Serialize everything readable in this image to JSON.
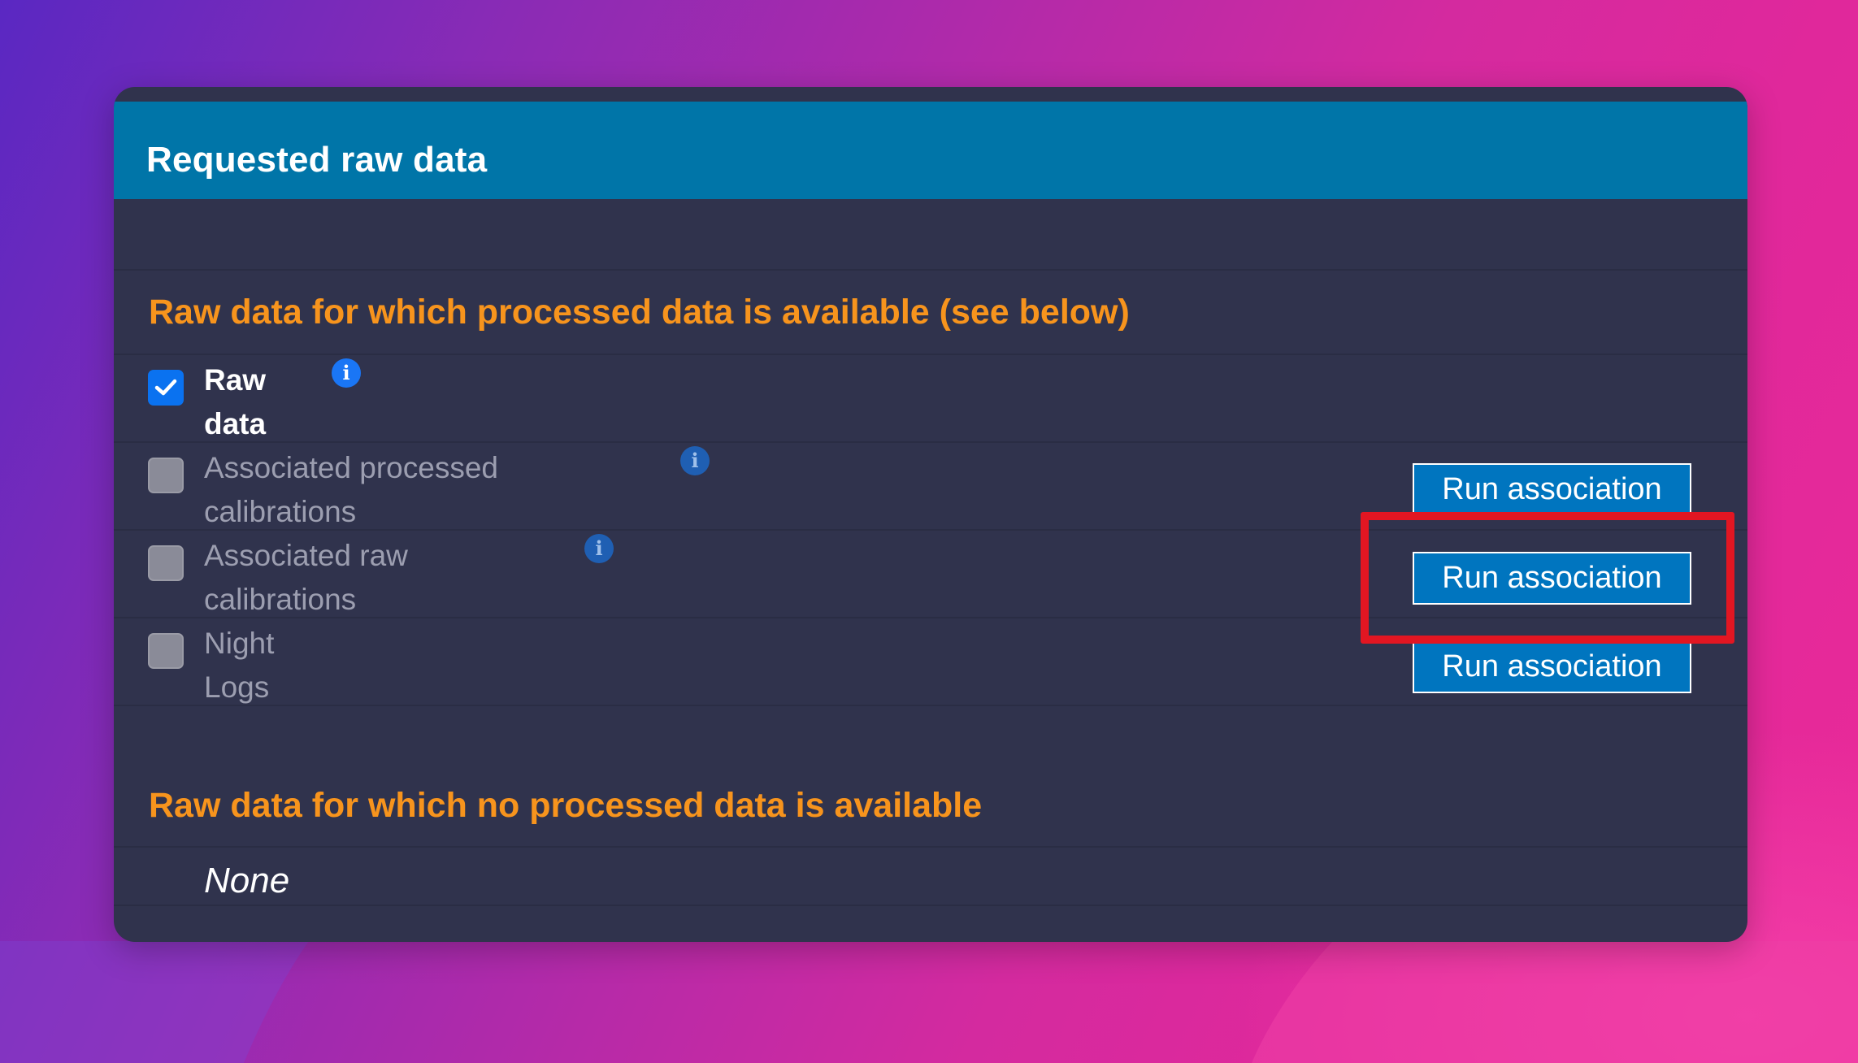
{
  "colors": {
    "header_bg": "#0075a8",
    "panel_bg": "#30334d",
    "heading_orange": "#f7941d",
    "button_blue": "#0075bf",
    "highlight_red": "#e21622",
    "checkbox_checked": "#0a72f0"
  },
  "panel": {
    "title": "Requested raw data"
  },
  "available_section": {
    "heading": "Raw data for which processed data is available (see below)",
    "rows": [
      {
        "label_line1": "Raw",
        "label_line2": "data",
        "checked": true,
        "enabled": true,
        "icon": "info-icon"
      },
      {
        "label_line1": "Associated processed",
        "label_line2": "calibrations",
        "checked": false,
        "enabled": false,
        "icon": "info-icon",
        "button_label": "Run association"
      },
      {
        "label_line1": "Associated raw",
        "label_line2": "calibrations",
        "checked": false,
        "enabled": false,
        "icon": "info-icon",
        "button_label": "Run association",
        "highlighted": true
      },
      {
        "label_line1": "Night",
        "label_line2": "Logs",
        "checked": false,
        "enabled": false,
        "button_label": "Run association"
      }
    ]
  },
  "unavailable_section": {
    "heading": "Raw data for which no processed data is available",
    "empty_text": "None"
  }
}
